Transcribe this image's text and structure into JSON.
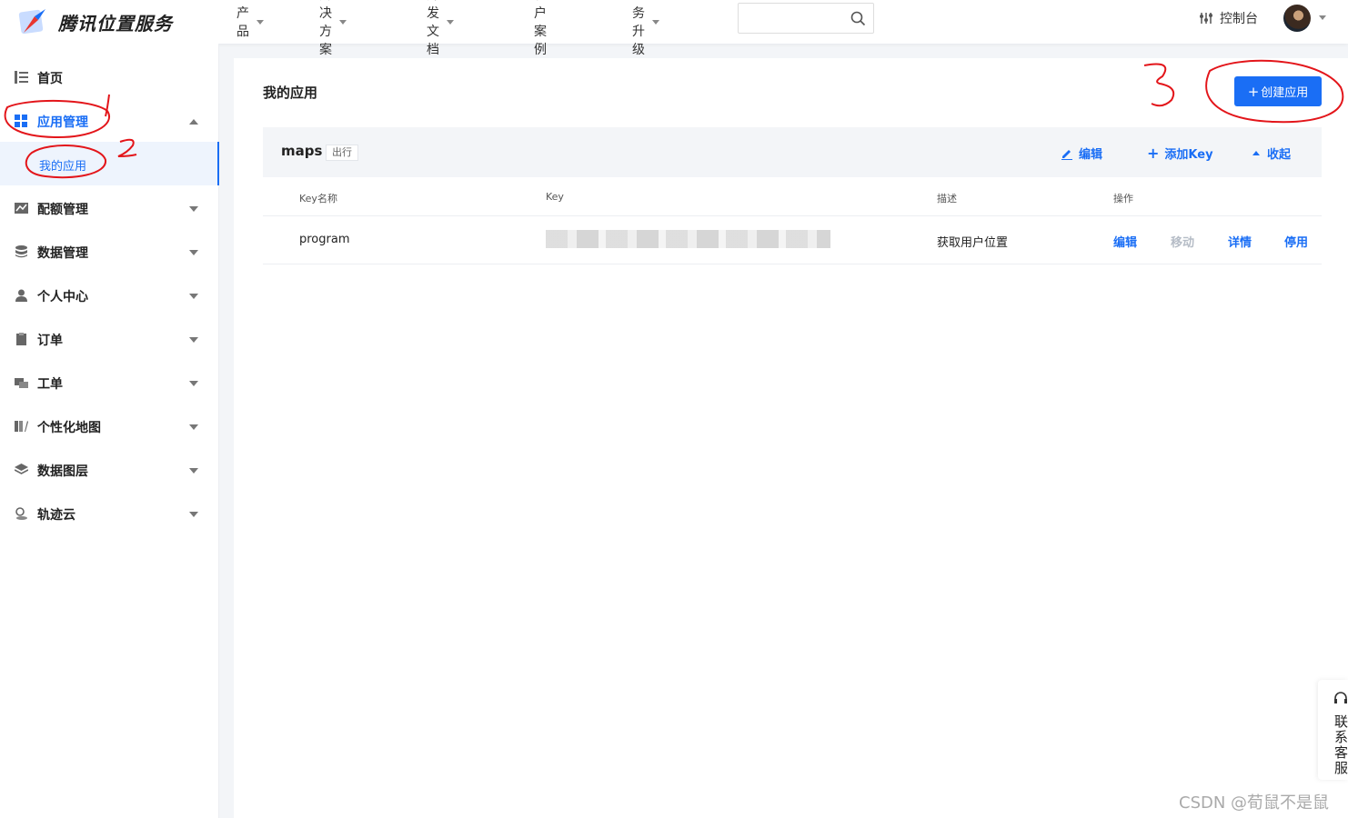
{
  "brand": {
    "name": "腾讯位置服务"
  },
  "nav": {
    "items": [
      {
        "label": "产品",
        "has_caret": true
      },
      {
        "label": "解决方案",
        "has_caret": true
      },
      {
        "label": "开发文档",
        "has_caret": true
      },
      {
        "label": "客户案例",
        "has_caret": false
      },
      {
        "label": "服务升级",
        "has_caret": true
      }
    ],
    "search_placeholder": "",
    "console_label": "控制台"
  },
  "sidebar": {
    "items": [
      {
        "label": "首页",
        "icon": "list-icon"
      },
      {
        "label": "应用管理",
        "icon": "grid-icon",
        "expanded": true
      },
      {
        "label": "配额管理",
        "icon": "chart-icon"
      },
      {
        "label": "数据管理",
        "icon": "database-icon"
      },
      {
        "label": "个人中心",
        "icon": "user-icon"
      },
      {
        "label": "订单",
        "icon": "clipboard-icon"
      },
      {
        "label": "工单",
        "icon": "ticket-icon"
      },
      {
        "label": "个性化地图",
        "icon": "map-style-icon"
      },
      {
        "label": "数据图层",
        "icon": "layers-icon"
      },
      {
        "label": "轨迹云",
        "icon": "location-icon"
      }
    ],
    "sub_item": {
      "label": "我的应用"
    }
  },
  "main": {
    "title": "我的应用",
    "create_button": {
      "plus": "+",
      "label": "创建应用"
    },
    "app_group": {
      "name": "maps",
      "tag": "出行",
      "actions": {
        "edit": "编辑",
        "add_key": "添加Key",
        "collapse": "收起"
      }
    },
    "table": {
      "headers": {
        "key_name": "Key名称",
        "key": "Key",
        "desc": "描述",
        "ops": "操作"
      },
      "rows": [
        {
          "key_name": "program",
          "desc": "获取用户位置",
          "ops": {
            "edit": "编辑",
            "move": "移动",
            "detail": "详情",
            "disable": "停用"
          }
        }
      ]
    }
  },
  "contact": {
    "label": "联系客服"
  },
  "watermark": "CSDN @荀鼠不是鼠",
  "annotations": {
    "one": "1",
    "two": "2",
    "three": "3"
  },
  "colors": {
    "accent": "#1a6ef5",
    "disabled": "#b5bcc6",
    "annotation": "#e3151a"
  }
}
